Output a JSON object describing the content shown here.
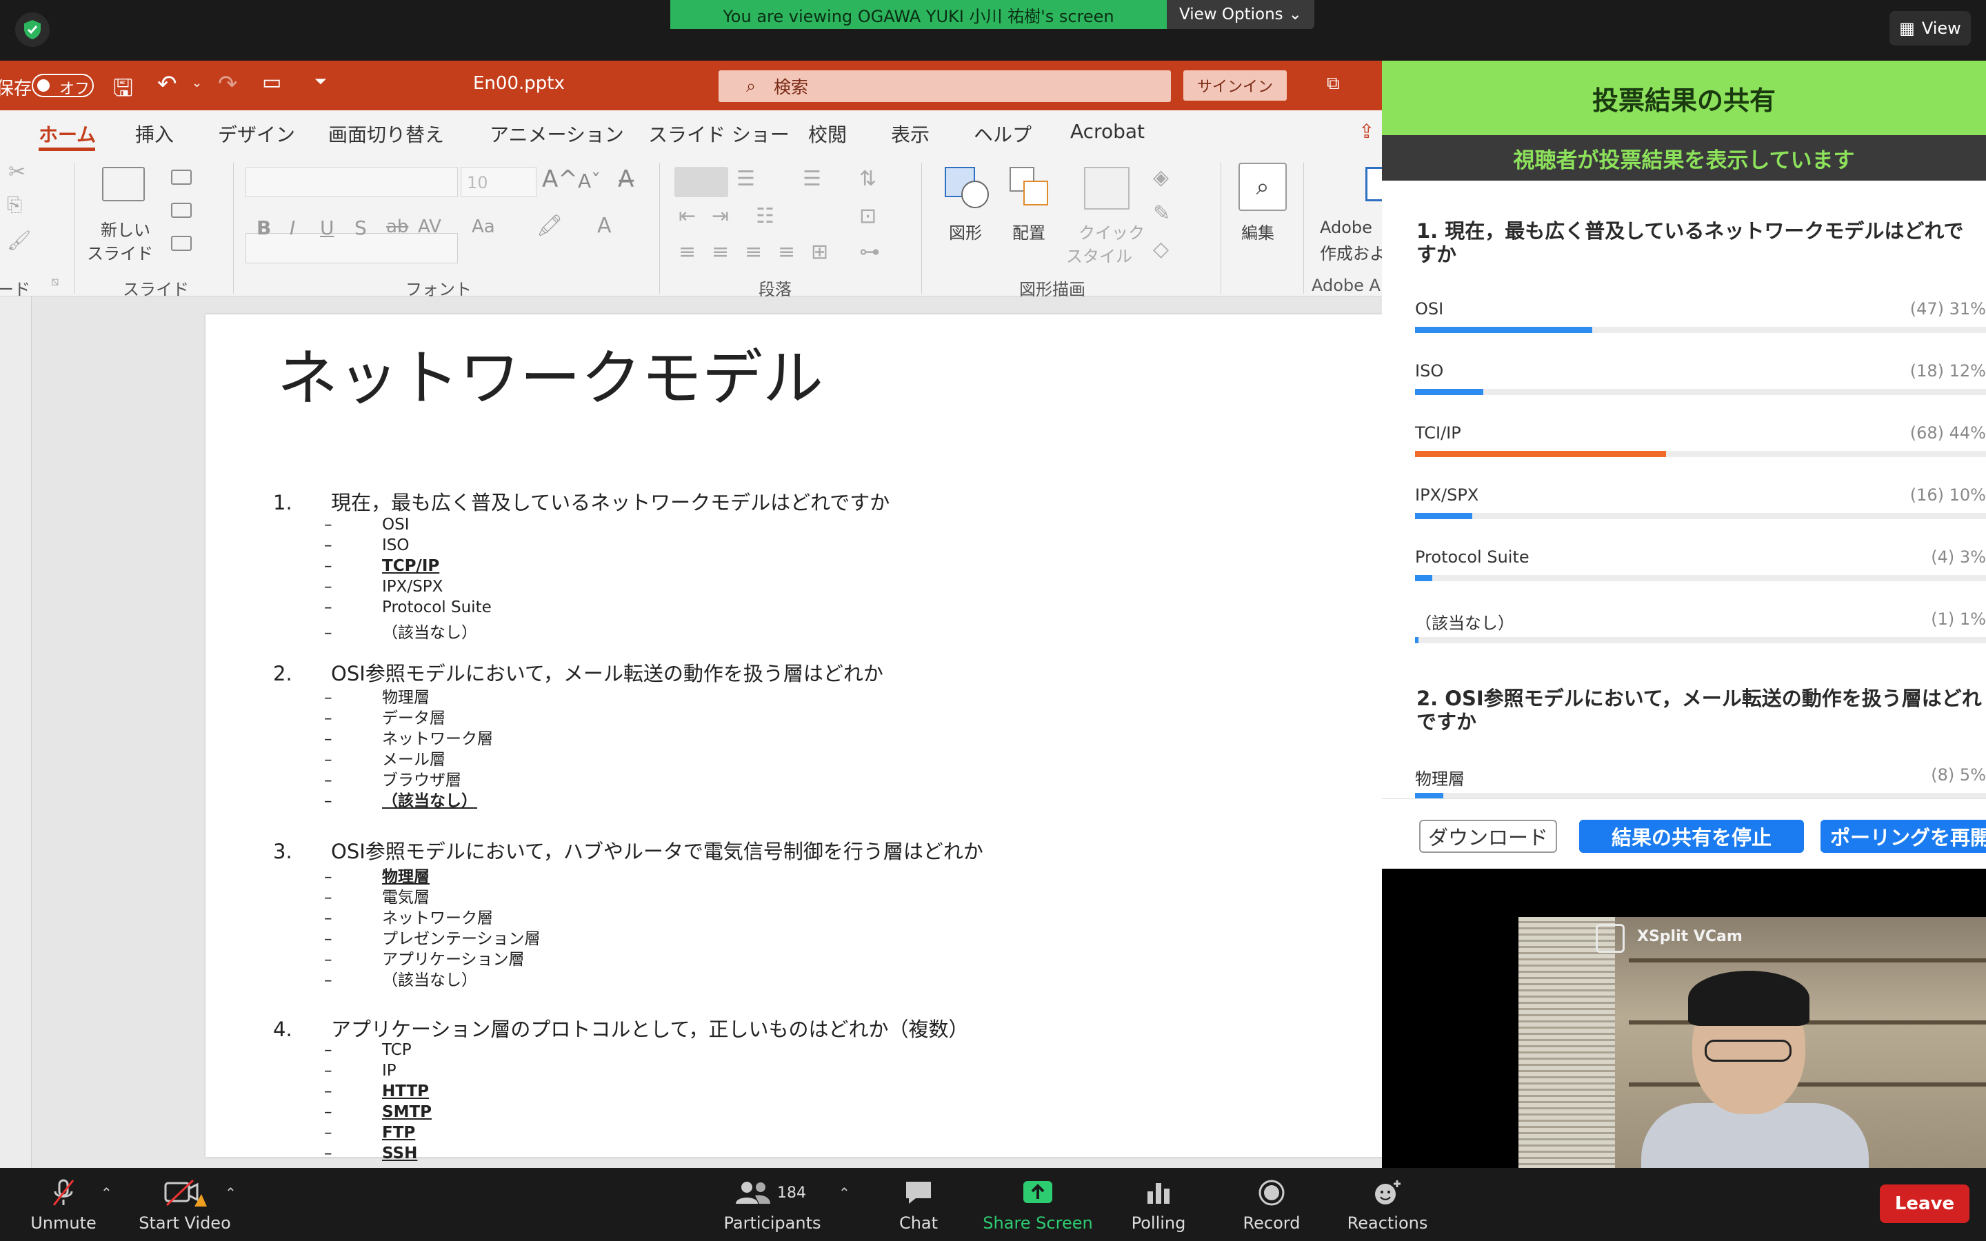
{
  "zoom": {
    "share_banner": "You are viewing OGAWA YUKI 小川 祐樹's screen",
    "view_options": "View Options",
    "view": "View",
    "bottom": {
      "unmute": "Unmute",
      "start_video": "Start Video",
      "participants": "Participants",
      "participants_count": "184",
      "chat": "Chat",
      "share_screen": "Share Screen",
      "polling": "Polling",
      "record": "Record",
      "reactions": "Reactions",
      "leave": "Leave"
    }
  },
  "ppt": {
    "autosave_label": "保存",
    "autosave_state": "オフ",
    "filename": "En00.pptx",
    "search_placeholder": "検索",
    "signin": "サインイン",
    "tabs": [
      "ホーム",
      "挿入",
      "デザイン",
      "画面切り替え",
      "アニメーション",
      "スライド ショー",
      "校閲",
      "表示",
      "ヘルプ",
      "Acrobat"
    ],
    "ribbon": {
      "new_slide_1": "新しい",
      "new_slide_2": "スライド",
      "group_slides": "スライド",
      "group_font": "フォント",
      "group_paragraph": "段落",
      "group_drawing": "図形描画",
      "group_clipboard": "ード",
      "group_adobe": "Adobe A",
      "font_size": "10",
      "shapes": "図形",
      "arrange": "配置",
      "quick_style_1": "クイック",
      "quick_style_2": "スタイル",
      "edit": "編集",
      "adobe_1": "Adobe",
      "adobe_2": "作成およ"
    },
    "slide": {
      "title": "ネットワークモデル",
      "questions": [
        {
          "num": "1.",
          "text": "現在，最も広く普及しているネットワークモデルはどれですか",
          "options": [
            "OSI",
            "ISO",
            "TCP/IP",
            "IPX/SPX",
            "Protocol Suite",
            "（該当なし）"
          ],
          "correct": [
            2
          ]
        },
        {
          "num": "2.",
          "text": "OSI参照モデルにおいて，メール転送の動作を扱う層はどれか",
          "options": [
            "物理層",
            "データ層",
            "ネットワーク層",
            "メール層",
            "ブラウザ層",
            "（該当なし）"
          ],
          "correct": [
            5
          ]
        },
        {
          "num": "3.",
          "text": "OSI参照モデルにおいて，ハブやルータで電気信号制御を行う層はどれか",
          "options": [
            "物理層",
            "電気層",
            "ネットワーク層",
            "プレゼンテーション層",
            "アプリケーション層",
            "（該当なし）"
          ],
          "correct": [
            0
          ]
        },
        {
          "num": "4.",
          "text": "アプリケーション層のプロトコルとして，正しいものはどれか（複数）",
          "options": [
            "TCP",
            "IP",
            "HTTP",
            "SMTP",
            "FTP",
            "SSH"
          ],
          "correct": [
            2,
            3,
            4,
            5
          ]
        }
      ],
      "dash": "–"
    }
  },
  "poll": {
    "title": "投票結果の共有",
    "subtitle": "視聴者が投票結果を表示しています",
    "q1": "1. 現在，最も広く普及しているネットワークモデルはどれですか",
    "answers": [
      {
        "label": "OSI",
        "value": "(47) 31%",
        "pct": 0.31,
        "color": "#2d8cf0"
      },
      {
        "label": "ISO",
        "value": "(18) 12%",
        "pct": 0.12,
        "color": "#2d8cf0"
      },
      {
        "label": "TCI/IP",
        "value": "(68) 44%",
        "pct": 0.44,
        "color": "#f06a2a"
      },
      {
        "label": "IPX/SPX",
        "value": "(16) 10%",
        "pct": 0.1,
        "color": "#2d8cf0"
      },
      {
        "label": "Protocol Suite",
        "value": "(4) 3%",
        "pct": 0.03,
        "color": "#2d8cf0"
      },
      {
        "label": "（該当なし）",
        "value": "(1) 1%",
        "pct": 0.01,
        "color": "#2d8cf0"
      }
    ],
    "q2": "2. OSI参照モデルにおいて，メール転送の動作を扱う層はどれですか",
    "q2_first": {
      "label": "物理層",
      "value": "(8) 5%",
      "pct": 0.05
    },
    "download": "ダウンロード",
    "stop_sharing": "結果の共有を停止",
    "reopen": "ポーリングを再開"
  },
  "camera": {
    "label": "XSplit VCam"
  }
}
